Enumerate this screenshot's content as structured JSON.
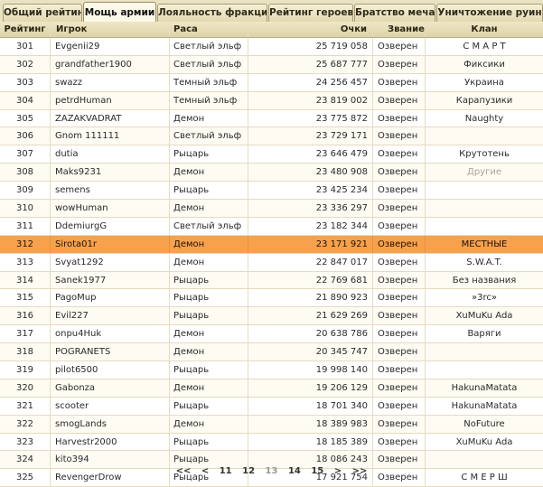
{
  "tabs": [
    {
      "label": "Общий рейтинг"
    },
    {
      "label": "Мощь армии"
    },
    {
      "label": "Лояльность фракции"
    },
    {
      "label": "Рейтинг героев"
    },
    {
      "label": "Братство меча"
    },
    {
      "label": "Уничтожение руин"
    }
  ],
  "active_tab": 1,
  "columns": {
    "rank": "Рейтинг",
    "player": "Игрок",
    "race": "Раса",
    "points": "Очки",
    "title": "Звание",
    "clan": "Клан"
  },
  "selected_rank": "312",
  "rows": [
    {
      "rank": "301",
      "player": "Evgenii29",
      "race": "Светлый эльф",
      "points": "25 719 058",
      "title": "Озверен",
      "clan": "С М А Р Т"
    },
    {
      "rank": "302",
      "player": "grandfather1900",
      "race": "Светлый эльф",
      "points": "25 687 777",
      "title": "Озверен",
      "clan": "Фиксики"
    },
    {
      "rank": "303",
      "player": "swazz",
      "race": "Темный эльф",
      "points": "24 256 457",
      "title": "Озверен",
      "clan": "Украина"
    },
    {
      "rank": "304",
      "player": "petrdHuman",
      "race": "Темный эльф",
      "points": "23 819 002",
      "title": "Озверен",
      "clan": "Карапузики"
    },
    {
      "rank": "305",
      "player": "ZAZAKVADRAT",
      "race": "Демон",
      "points": "23 775 872",
      "title": "Озверен",
      "clan": "Naughty"
    },
    {
      "rank": "306",
      "player": "Gnom 111111",
      "race": "Светлый эльф",
      "points": "23 729 171",
      "title": "Озверен",
      "clan": ""
    },
    {
      "rank": "307",
      "player": "dutia",
      "race": "Рыцарь",
      "points": "23 646 479",
      "title": "Озверен",
      "clan": "Крутотень"
    },
    {
      "rank": "308",
      "player": "Maks9231",
      "race": "Демон",
      "points": "23 480 908",
      "title": "Озверен",
      "clan": "Другие"
    },
    {
      "rank": "309",
      "player": "semens",
      "race": "Рыцарь",
      "points": "23 425 234",
      "title": "Озверен",
      "clan": ""
    },
    {
      "rank": "310",
      "player": "wowHuman",
      "race": "Демон",
      "points": "23 336 297",
      "title": "Озверен",
      "clan": ""
    },
    {
      "rank": "311",
      "player": "DdemiurgG",
      "race": "Светлый эльф",
      "points": "23 182 344",
      "title": "Озверен",
      "clan": ""
    },
    {
      "rank": "312",
      "player": "Sirota01r",
      "race": "Демон",
      "points": "23 171 921",
      "title": "Озверен",
      "clan": "МЕСТНЫЕ"
    },
    {
      "rank": "313",
      "player": "Svyat1292",
      "race": "Демон",
      "points": "22 847 017",
      "title": "Озверен",
      "clan": "S.W.A.T."
    },
    {
      "rank": "314",
      "player": "Sanek1977",
      "race": "Рыцарь",
      "points": "22 769 681",
      "title": "Озверен",
      "clan": "Без названия"
    },
    {
      "rank": "315",
      "player": "PagoMup",
      "race": "Рыцарь",
      "points": "21 890 923",
      "title": "Озверен",
      "clan": "»3rc»"
    },
    {
      "rank": "316",
      "player": "Evil227",
      "race": "Рыцарь",
      "points": "21 629 269",
      "title": "Озверен",
      "clan": "XuMuKu Ada"
    },
    {
      "rank": "317",
      "player": "onpu4Huk",
      "race": "Демон",
      "points": "20 638 786",
      "title": "Озверен",
      "clan": "Варяги"
    },
    {
      "rank": "318",
      "player": "POGRANETS",
      "race": "Демон",
      "points": "20 345 747",
      "title": "Озверен",
      "clan": ""
    },
    {
      "rank": "319",
      "player": "pilot6500",
      "race": "Рыцарь",
      "points": "19 998 140",
      "title": "Озверен",
      "clan": ""
    },
    {
      "rank": "320",
      "player": "Gabonza",
      "race": "Демон",
      "points": "19 206 129",
      "title": "Озверен",
      "clan": "HakunaMatata"
    },
    {
      "rank": "321",
      "player": "scooter",
      "race": "Рыцарь",
      "points": "18 701 340",
      "title": "Озверен",
      "clan": "HakunaMatata"
    },
    {
      "rank": "322",
      "player": "smogLands",
      "race": "Демон",
      "points": "18 389 983",
      "title": "Озверен",
      "clan": "NoFuture"
    },
    {
      "rank": "323",
      "player": "Harvestr2000",
      "race": "Рыцарь",
      "points": "18 185 389",
      "title": "Озверен",
      "clan": "XuMuKu Ada"
    },
    {
      "rank": "324",
      "player": "kito394",
      "race": "Рыцарь",
      "points": "18 086 243",
      "title": "Озверен",
      "clan": ""
    },
    {
      "rank": "325",
      "player": "RevengerDrow",
      "race": "Рыцарь",
      "points": "17 921 754",
      "title": "Озверен",
      "clan": "С М Е Р Ш"
    }
  ],
  "muted_clans": [
    "Другие"
  ],
  "pager": {
    "first": "<<",
    "prev": "<",
    "pages": [
      "11",
      "12",
      "13",
      "14",
      "15"
    ],
    "current": "13",
    "next": ">",
    "last": ">>"
  },
  "colors": {
    "selected_row": "#f7a14c",
    "muted_text": "#a9a49a"
  }
}
